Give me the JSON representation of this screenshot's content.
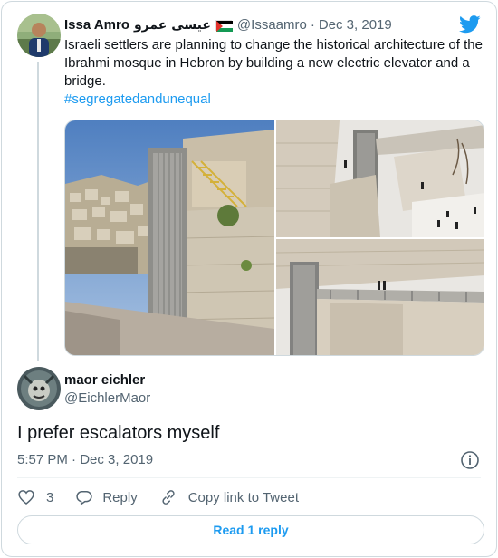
{
  "parent_tweet": {
    "name": "Issa Amro",
    "name_arabic": "عيسى عمرو",
    "handle": "@Issaamro",
    "date": "Dec 3, 2019",
    "text": "Israeli settlers are planning to change the historical architecture of the Ibrahmi mosque in Hebron by building a new electric elevator and a bridge.",
    "hashtag": "#segregatedandunequal",
    "flag_icon": "palestine-flag-icon",
    "brand_icon": "twitter-bird-icon"
  },
  "reply_tweet": {
    "name": "maor eichler",
    "handle": "@EichlerMaor",
    "text": "I prefer escalators myself",
    "time": "5:57 PM",
    "date": "Dec 3, 2019"
  },
  "actions": {
    "like_count": "3",
    "reply_label": "Reply",
    "copy_link_label": "Copy link to Tweet"
  },
  "read_replies_label": "Read 1 reply",
  "colors": {
    "accent": "#1d9bf0",
    "muted": "#536471",
    "border": "#cfd9de"
  }
}
